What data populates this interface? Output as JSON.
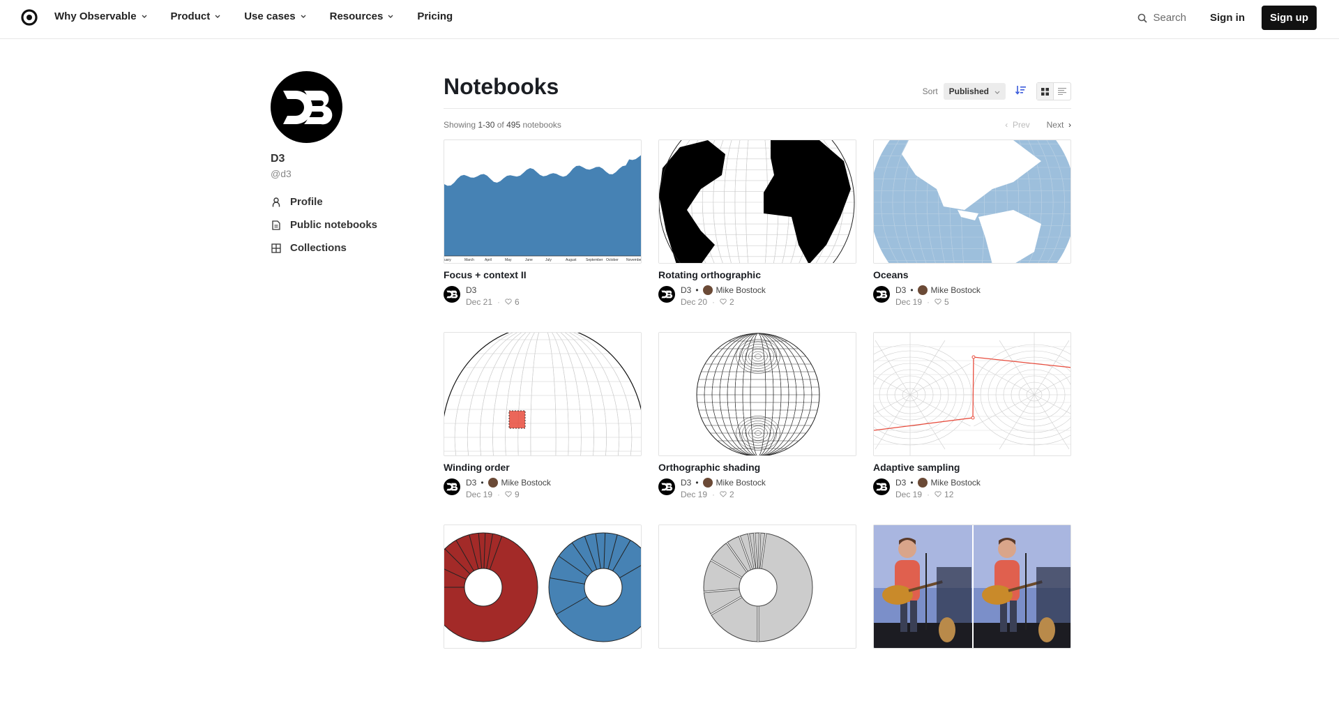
{
  "nav": {
    "items": [
      {
        "label": "Why Observable",
        "has_menu": true
      },
      {
        "label": "Product",
        "has_menu": true
      },
      {
        "label": "Use cases",
        "has_menu": true
      },
      {
        "label": "Resources",
        "has_menu": true
      },
      {
        "label": "Pricing",
        "has_menu": false
      }
    ],
    "search_label": "Search",
    "signin_label": "Sign in",
    "signup_label": "Sign up"
  },
  "profile": {
    "name": "D3",
    "handle": "@d3",
    "links": [
      {
        "label": "Profile",
        "icon": "person-icon"
      },
      {
        "label": "Public notebooks",
        "icon": "document-icon"
      },
      {
        "label": "Collections",
        "icon": "grid-icon"
      }
    ]
  },
  "main": {
    "title": "Notebooks",
    "sort_label": "Sort",
    "sort_value": "Published",
    "showing_prefix": "Showing",
    "showing_range": "1-30",
    "showing_of": "of",
    "showing_total": "495",
    "showing_suffix": "notebooks",
    "prev_label": "Prev",
    "next_label": "Next"
  },
  "notebooks": [
    {
      "title": "Focus + context II",
      "owner": "D3",
      "coauthor": "",
      "date": "Dec 21",
      "likes": "6",
      "thumb": "area-chart"
    },
    {
      "title": "Rotating orthographic",
      "owner": "D3",
      "coauthor": "Mike Bostock",
      "date": "Dec 20",
      "likes": "2",
      "thumb": "black-globe"
    },
    {
      "title": "Oceans",
      "owner": "D3",
      "coauthor": "Mike Bostock",
      "date": "Dec 19",
      "likes": "5",
      "thumb": "ocean-globe"
    },
    {
      "title": "Winding order",
      "owner": "D3",
      "coauthor": "Mike Bostock",
      "date": "Dec 19",
      "likes": "9",
      "thumb": "winding-globe"
    },
    {
      "title": "Orthographic shading",
      "owner": "D3",
      "coauthor": "Mike Bostock",
      "date": "Dec 19",
      "likes": "2",
      "thumb": "shading-sphere"
    },
    {
      "title": "Adaptive sampling",
      "owner": "D3",
      "coauthor": "Mike Bostock",
      "date": "Dec 19",
      "likes": "12",
      "thumb": "adaptive-grid"
    },
    {
      "title": "",
      "owner": "",
      "coauthor": "",
      "date": "",
      "likes": "",
      "thumb": "donuts"
    },
    {
      "title": "",
      "owner": "",
      "coauthor": "",
      "date": "",
      "likes": "",
      "thumb": "gray-donut"
    },
    {
      "title": "",
      "owner": "",
      "coauthor": "",
      "date": "",
      "likes": "",
      "thumb": "photo"
    }
  ],
  "area_axis_labels": [
    "uary",
    "March",
    "April",
    "May",
    "June",
    "July",
    "August",
    "September",
    "October",
    "November"
  ],
  "colors": {
    "steelblue": "#4682b4",
    "ocean": "#9dbfdc",
    "red": "#e84c3d",
    "firebrick": "#a32a28"
  }
}
